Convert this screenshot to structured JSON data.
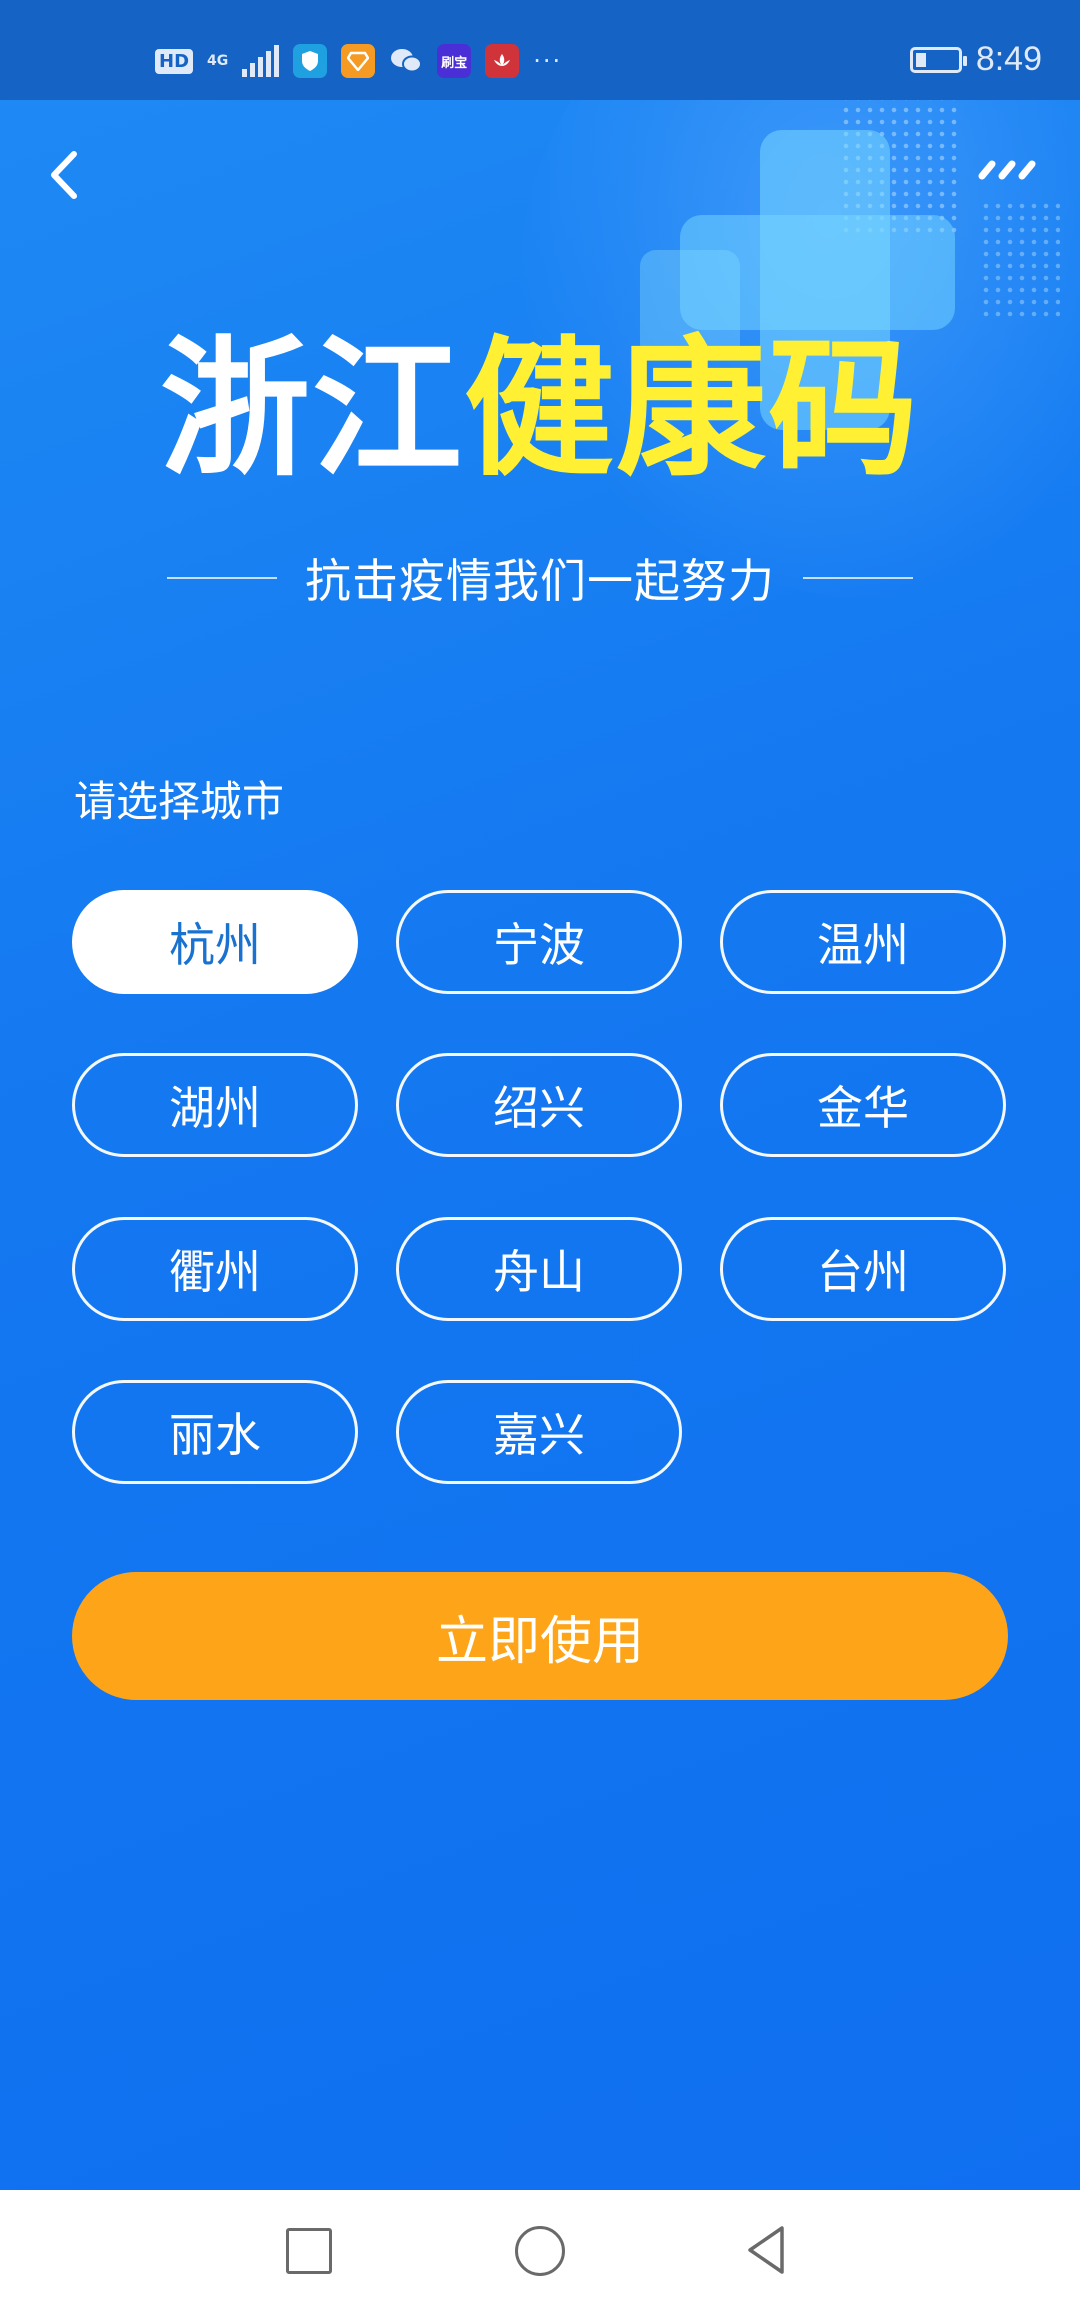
{
  "status_bar": {
    "hd": "HD",
    "network": "4G",
    "app_icons": [
      "shield-app-icon",
      "diamond-app-icon",
      "wechat-icon",
      "刷宝",
      "lotus-app-icon"
    ],
    "overflow": "···",
    "time": "8:49",
    "battery_level": 0.2
  },
  "header": {
    "back_icon": "chevron-left-icon",
    "more_icon": "more-dots-icon"
  },
  "title": {
    "part1": "浙江",
    "part2": "健康码",
    "accent_color": "#fff033"
  },
  "subtitle": "抗击疫情我们一起努力",
  "select_city_label": "请选择城市",
  "cities": [
    {
      "name": "杭州",
      "selected": true
    },
    {
      "name": "宁波",
      "selected": false
    },
    {
      "name": "温州",
      "selected": false
    },
    {
      "name": "湖州",
      "selected": false
    },
    {
      "name": "绍兴",
      "selected": false
    },
    {
      "name": "金华",
      "selected": false
    },
    {
      "name": "衢州",
      "selected": false
    },
    {
      "name": "舟山",
      "selected": false
    },
    {
      "name": "台州",
      "selected": false
    },
    {
      "name": "丽水",
      "selected": false
    },
    {
      "name": "嘉兴",
      "selected": false
    }
  ],
  "use_button": "立即使用",
  "colors": {
    "background": "#1478f1",
    "button": "#fea418",
    "selected_text": "#1a72d0"
  },
  "nav_bar": {
    "recents_icon": "square-icon",
    "home_icon": "circle-icon",
    "back_icon": "triangle-back-icon"
  }
}
